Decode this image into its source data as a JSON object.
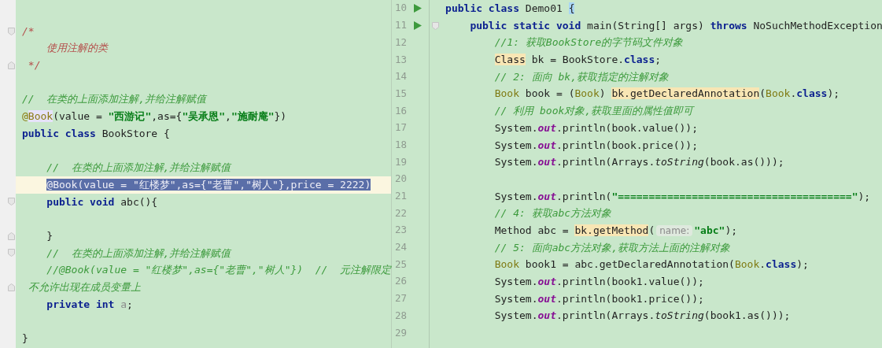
{
  "left_editor": {
    "blocks": [
      {
        "lines": [
          {
            "fold_start": true,
            "tokens": [
              {
                "kind": "block-comment",
                "text": "/*"
              }
            ]
          },
          {
            "tokens": [
              {
                "kind": "block-comment",
                "text": "    使用注解的类"
              }
            ]
          },
          {
            "fold_end": true,
            "tokens": [
              {
                "kind": "block-comment",
                "text": " */"
              }
            ]
          }
        ]
      },
      {
        "lines": [
          {
            "tokens": [
              {
                "kind": "comment",
                "text": "//  在类的上面添加注解,并给注解赋值"
              }
            ]
          },
          {
            "tokens": [
              {
                "kind": "annotation",
                "text": "@"
              },
              {
                "kind": "annotation-highlight",
                "text": "Book"
              },
              {
                "kind": "plain",
                "text": "(value = "
              },
              {
                "kind": "string",
                "text": "\"西游记\""
              },
              {
                "kind": "plain",
                "text": ",as={"
              },
              {
                "kind": "string",
                "text": "\"吴承恩\""
              },
              {
                "kind": "plain",
                "text": ","
              },
              {
                "kind": "string",
                "text": "\"施耐庵\""
              },
              {
                "kind": "plain",
                "text": "})"
              }
            ]
          },
          {
            "tokens": [
              {
                "kind": "keyword",
                "text": "public class"
              },
              {
                "kind": "plain",
                "text": " BookStore {"
              }
            ]
          }
        ]
      },
      {
        "lines": [
          {
            "tokens": [
              {
                "kind": "comment",
                "text": "    //  在类的上面添加注解,并给注解赋值"
              }
            ]
          },
          {
            "selected": true,
            "tokens": [
              {
                "kind": "annotation",
                "text": "    @Book(value = \"红楼梦\",as={\"老曹\",\"树人\"},price = 2222)"
              }
            ]
          },
          {
            "fold_start": true,
            "tokens": [
              {
                "kind": "keyword",
                "text": "    public void"
              },
              {
                "kind": "plain",
                "text": " abc(){"
              }
            ]
          }
        ]
      },
      {
        "lines": [
          {
            "fold_end": true,
            "tokens": [
              {
                "kind": "plain",
                "text": "    }"
              }
            ]
          },
          {
            "fold_start": true,
            "tokens": [
              {
                "kind": "comment",
                "text": "    //  在类的上面添加注解,并给注解赋值"
              }
            ]
          },
          {
            "tokens": [
              {
                "kind": "comment",
                "text": "    //@Book(value = \"红楼梦\",as={\"老曹\",\"树人\"})  //  元注解限定"
              }
            ]
          },
          {
            "fold_end": true,
            "tokens": [
              {
                "kind": "comment",
                "text": " 不允许出现在成员变量上"
              }
            ]
          },
          {
            "tokens": [
              {
                "kind": "keyword",
                "text": "    private int"
              },
              {
                "kind": "unused",
                "text": " a"
              },
              {
                "kind": "plain",
                "text": ";"
              }
            ]
          }
        ]
      },
      {
        "lines": [
          {
            "tokens": [
              {
                "kind": "plain",
                "text": "}"
              }
            ]
          }
        ]
      }
    ]
  },
  "right_editor": {
    "lines": [
      {
        "number": "10",
        "run": true,
        "tokens": [
          {
            "kind": "keyword",
            "text": "public class"
          },
          {
            "kind": "plain",
            "text": " Demo01 "
          },
          {
            "kind": "brace-highlight",
            "text": "{"
          }
        ]
      },
      {
        "number": "11",
        "run": true,
        "fold_start": true,
        "tokens": [
          {
            "kind": "keyword",
            "text": "    public static void"
          },
          {
            "kind": "plain",
            "text": " main(String[] args) "
          },
          {
            "kind": "keyword",
            "text": "throws"
          },
          {
            "kind": "plain",
            "text": " NoSuchMethodException"
          }
        ]
      },
      {
        "number": "12",
        "tokens": [
          {
            "kind": "comment",
            "text": "        //1: 获取BookStore的字节码文件对象"
          }
        ]
      },
      {
        "number": "13",
        "tokens": [
          {
            "kind": "type-highlight",
            "text": "        Class"
          },
          {
            "kind": "plain",
            "text": " bk = BookStore."
          },
          {
            "kind": "keyword",
            "text": "class"
          },
          {
            "kind": "plain",
            "text": ";"
          }
        ]
      },
      {
        "number": "14",
        "tokens": [
          {
            "kind": "comment",
            "text": "        // 2: 面向 bk,获取指定的注解对象"
          }
        ]
      },
      {
        "number": "15",
        "tokens": [
          {
            "kind": "type",
            "text": "        Book"
          },
          {
            "kind": "plain",
            "text": " book = ("
          },
          {
            "kind": "type",
            "text": "Book"
          },
          {
            "kind": "plain",
            "text": ") "
          },
          {
            "kind": "highlight",
            "text": "bk.getDeclaredAnnotation"
          },
          {
            "kind": "plain",
            "text": "("
          },
          {
            "kind": "type",
            "text": "Book"
          },
          {
            "kind": "plain",
            "text": "."
          },
          {
            "kind": "keyword",
            "text": "class"
          },
          {
            "kind": "plain",
            "text": ");"
          }
        ]
      },
      {
        "number": "16",
        "tokens": [
          {
            "kind": "comment",
            "text": "        // 利用 book对象,获取里面的属性值即可"
          }
        ]
      },
      {
        "number": "17",
        "tokens": [
          {
            "kind": "plain",
            "text": "        System."
          },
          {
            "kind": "field",
            "text": "out"
          },
          {
            "kind": "plain",
            "text": ".println(book.value());"
          }
        ]
      },
      {
        "number": "18",
        "tokens": [
          {
            "kind": "plain",
            "text": "        System."
          },
          {
            "kind": "field",
            "text": "out"
          },
          {
            "kind": "plain",
            "text": ".println(book.price());"
          }
        ]
      },
      {
        "number": "19",
        "tokens": [
          {
            "kind": "plain",
            "text": "        System."
          },
          {
            "kind": "field",
            "text": "out"
          },
          {
            "kind": "plain",
            "text": ".println(Arrays."
          },
          {
            "kind": "static-method",
            "text": "toString"
          },
          {
            "kind": "plain",
            "text": "(book.as()));"
          }
        ]
      },
      {
        "number": "20"
      },
      {
        "number": "21",
        "tokens": [
          {
            "kind": "plain",
            "text": "        System."
          },
          {
            "kind": "field",
            "text": "out"
          },
          {
            "kind": "plain",
            "text": ".println("
          },
          {
            "kind": "string",
            "text": "\"======================================\""
          },
          {
            "kind": "plain",
            "text": ");"
          }
        ]
      },
      {
        "number": "22",
        "tokens": [
          {
            "kind": "comment",
            "text": "        // 4: 获取abc方法对象"
          }
        ]
      },
      {
        "number": "23",
        "tokens": [
          {
            "kind": "plain",
            "text": "        Method abc = "
          },
          {
            "kind": "highlight",
            "text": "bk.getMethod"
          },
          {
            "kind": "plain",
            "text": "("
          },
          {
            "kind": "hint",
            "text": "name:"
          },
          {
            "kind": "string",
            "text": "\"abc\""
          },
          {
            "kind": "plain",
            "text": ");"
          }
        ]
      },
      {
        "number": "24",
        "tokens": [
          {
            "kind": "comment",
            "text": "        // 5: 面向abc方法对象,获取方法上面的注解对象"
          }
        ]
      },
      {
        "number": "25",
        "tokens": [
          {
            "kind": "type",
            "text": "        Book"
          },
          {
            "kind": "plain",
            "text": " book1 = abc.getDeclaredAnnotation("
          },
          {
            "kind": "type",
            "text": "Book"
          },
          {
            "kind": "plain",
            "text": "."
          },
          {
            "kind": "keyword",
            "text": "class"
          },
          {
            "kind": "plain",
            "text": ");"
          }
        ]
      },
      {
        "number": "26",
        "tokens": [
          {
            "kind": "plain",
            "text": "        System."
          },
          {
            "kind": "field",
            "text": "out"
          },
          {
            "kind": "plain",
            "text": ".println(book1.value());"
          }
        ]
      },
      {
        "number": "27",
        "tokens": [
          {
            "kind": "plain",
            "text": "        System."
          },
          {
            "kind": "field",
            "text": "out"
          },
          {
            "kind": "plain",
            "text": ".println(book1.price());"
          }
        ]
      },
      {
        "number": "28",
        "tokens": [
          {
            "kind": "plain",
            "text": "        System."
          },
          {
            "kind": "field",
            "text": "out"
          },
          {
            "kind": "plain",
            "text": ".println(Arrays."
          },
          {
            "kind": "static-method",
            "text": "toString"
          },
          {
            "kind": "plain",
            "text": "(book1.as()));"
          }
        ]
      },
      {
        "number": "29"
      }
    ]
  }
}
